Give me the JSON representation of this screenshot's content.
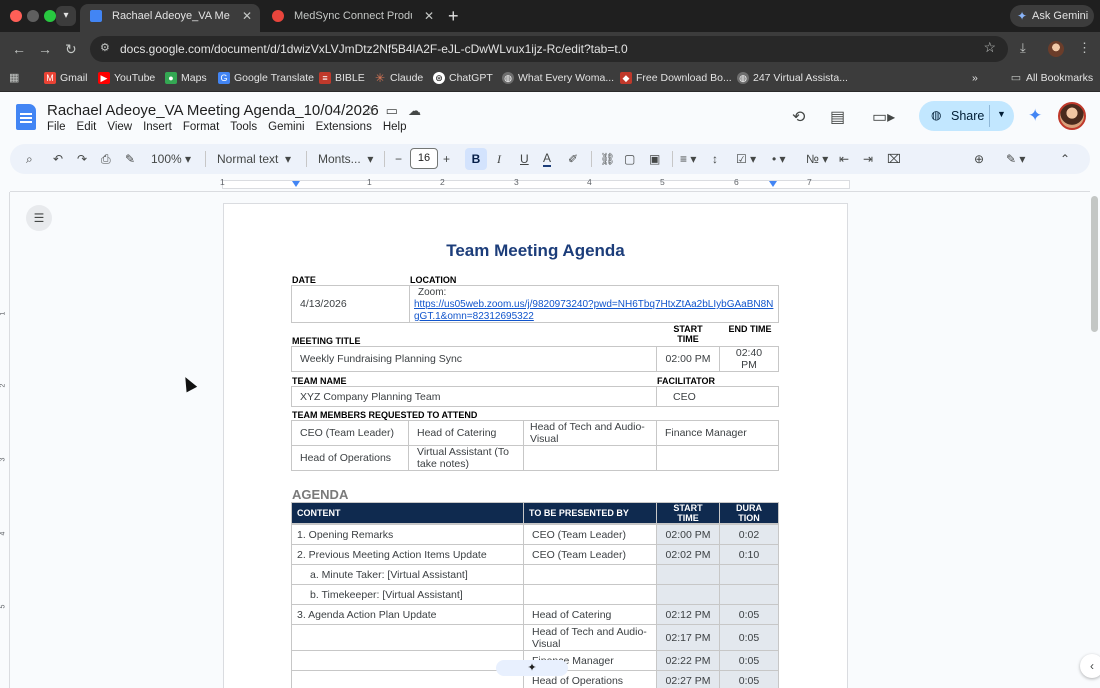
{
  "browser": {
    "tabs": [
      {
        "label": "Rachael Adeoye_VA Meeting",
        "favicon_color": "#4285f4"
      },
      {
        "label": "MedSync Connect Product",
        "favicon_color": "#e8453c"
      }
    ],
    "ask_gemini": "Ask Gemini",
    "url": "docs.google.com/document/d/1dwizVxLVJmDtz2Nf5B4lA2F-eJL-cDwWLvux1ijz-Rc/edit?tab=t.0",
    "bookmarks": [
      {
        "label": "Gmail",
        "icon": "gmail-icon",
        "color": "#ea4335"
      },
      {
        "label": "YouTube",
        "icon": "youtube-icon",
        "color": "#ff0000"
      },
      {
        "label": "Maps",
        "icon": "maps-icon",
        "color": "#34a853"
      },
      {
        "label": "Google Translate",
        "icon": "translate-icon",
        "color": "#4285f4"
      },
      {
        "label": "BIBLE",
        "icon": "bible-icon",
        "color": "#c0392b"
      },
      {
        "label": "Claude",
        "icon": "claude-icon",
        "color": "#d97757"
      },
      {
        "label": "ChatGPT",
        "icon": "chatgpt-icon",
        "color": "#6e6e6e"
      },
      {
        "label": "What Every Woma...",
        "icon": "globe-icon",
        "color": "#8a8a8a"
      },
      {
        "label": "Free Download Bo...",
        "icon": "book-icon",
        "color": "#c0392b"
      },
      {
        "label": "247 Virtual Assista...",
        "icon": "globe-icon",
        "color": "#8a8a8a"
      }
    ],
    "all_bookmarks": "All Bookmarks"
  },
  "docs": {
    "title": "Rachael Adeoye_VA Meeting Agenda_10/04/2026",
    "menu": [
      "File",
      "Edit",
      "View",
      "Insert",
      "Format",
      "Tools",
      "Gemini",
      "Extensions",
      "Help"
    ],
    "share": "Share",
    "toolbar": {
      "zoom": "100%",
      "style": "Normal text",
      "font": "Monts...",
      "font_size": "16",
      "bold": "B",
      "italic": "I",
      "underline": "U"
    },
    "ruler_numbers": [
      "1",
      "1",
      "2",
      "3",
      "4",
      "5",
      "6",
      "7"
    ],
    "vruler_numbers": [
      "1",
      "2",
      "3",
      "4",
      "5"
    ]
  },
  "agenda": {
    "title": "Team Meeting Agenda",
    "date_label": "DATE",
    "location_label": "LOCATION",
    "date": "4/13/2026",
    "location_prefix": "Zoom:",
    "location_link": "https://us05web.zoom.us/j/9820973240?pwd=NH6Tbq7HtxZtAa2bLIybGAaBN8NgGT.1&omn=82312695322",
    "meeting_title_label": "MEETING TITLE",
    "start_time_label": "START TIME",
    "end_time_label": "END TIME",
    "meeting_title": "Weekly Fundraising Planning Sync",
    "start_time": "02:00 PM",
    "end_time": "02:40 PM",
    "team_name_label": "TEAM NAME",
    "facilitator_label": "FACILITATOR",
    "team_name": "XYZ Company Planning Team",
    "facilitator": "CEO",
    "attendees_label": "TEAM MEMBERS REQUESTED TO ATTEND",
    "attendees": [
      "CEO (Team Leader)",
      "Head of Catering",
      "Head of Tech and Audio-Visual",
      "Finance Manager",
      "Head of Operations",
      "Virtual Assistant (To take notes)",
      "",
      ""
    ],
    "agenda_heading": "AGENDA",
    "columns": [
      "CONTENT",
      "TO BE PRESENTED BY",
      "START TIME",
      "DURATION"
    ],
    "rows": [
      {
        "content": "1. Opening Remarks",
        "presenter": "CEO (Team Leader)",
        "start": "02:00 PM",
        "duration": "0:02"
      },
      {
        "content": "2. Previous Meeting Action Items Update",
        "presenter": "CEO (Team Leader)",
        "start": "02:02 PM",
        "duration": "0:10"
      },
      {
        "content": "a. Minute Taker: [Virtual Assistant]",
        "presenter": "",
        "start": "",
        "duration": ""
      },
      {
        "content": "b. Timekeeper: [Virtual Assistant]",
        "presenter": "",
        "start": "",
        "duration": ""
      },
      {
        "content": "3. Agenda Action Plan Update",
        "presenter": "Head of Catering",
        "start": "02:12 PM",
        "duration": "0:05"
      },
      {
        "content": "",
        "presenter": "Head of Tech and Audio-Visual",
        "start": "02:17 PM",
        "duration": "0:05"
      },
      {
        "content": "",
        "presenter": "Finance Manager",
        "start": "02:22 PM",
        "duration": "0:05"
      },
      {
        "content": "",
        "presenter": "Head of Operations",
        "start": "02:27 PM",
        "duration": "0:05"
      }
    ]
  }
}
